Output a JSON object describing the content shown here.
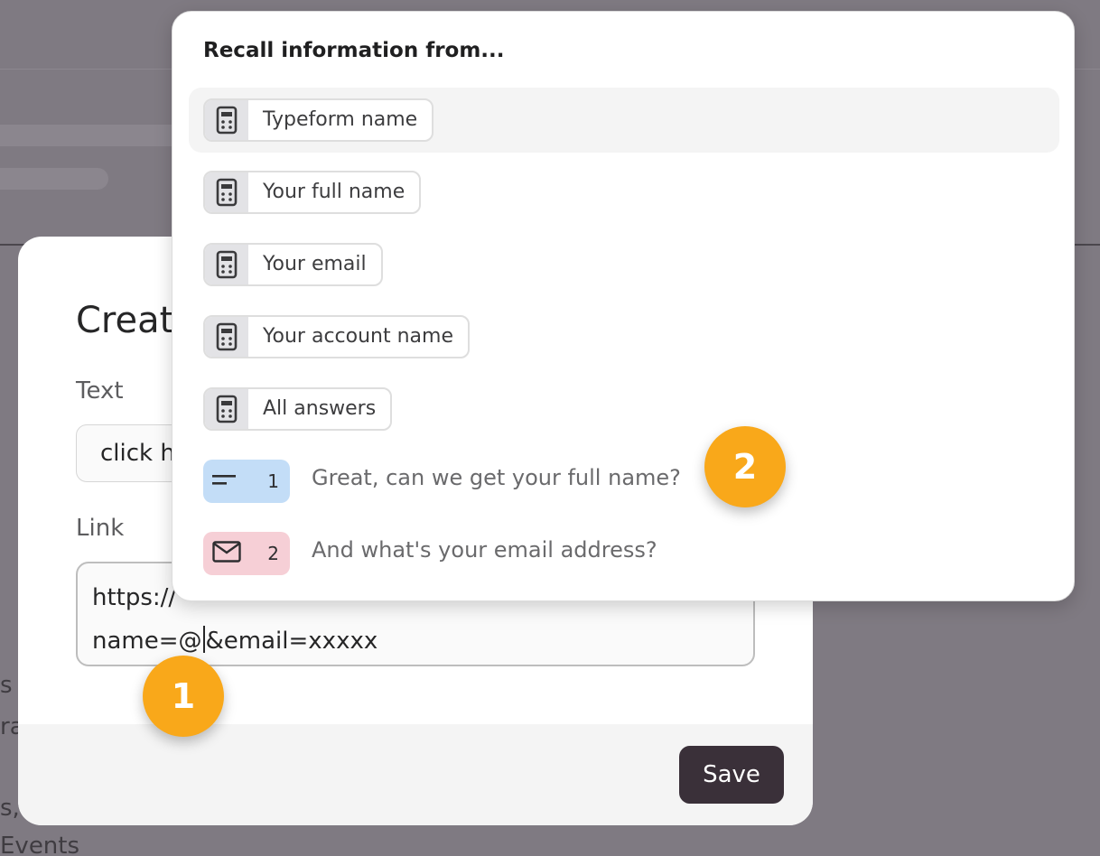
{
  "background": {
    "fragments": [
      "s",
      "ra",
      "s,",
      "Events"
    ]
  },
  "modal": {
    "title": "Create",
    "text_label": "Text",
    "text_value": "click h",
    "link_label": "Link",
    "link_line1": "https://",
    "link_before_caret": "name=@",
    "link_after_caret": "&email=xxxxx",
    "save_label": "Save"
  },
  "recall": {
    "title": "Recall information from...",
    "variables": [
      {
        "label": "Typeform name",
        "icon": "calculator-icon",
        "highlighted": true
      },
      {
        "label": "Your full name",
        "icon": "calculator-icon"
      },
      {
        "label": "Your email",
        "icon": "calculator-icon"
      },
      {
        "label": "Your account name",
        "icon": "calculator-icon"
      },
      {
        "label": "All answers",
        "icon": "calculator-icon"
      }
    ],
    "questions": [
      {
        "number": "1",
        "icon": "short-text-icon",
        "text": "Great, can we get your full name?",
        "color": "#c3ddf7"
      },
      {
        "number": "2",
        "icon": "email-icon",
        "text": "And what's your email address?",
        "color": "#f6cfd6"
      }
    ]
  },
  "markers": [
    "1",
    "2"
  ],
  "colors": {
    "marker": "#f9a81a",
    "save_button": "#3a3039",
    "overlay": "#7f7a82"
  }
}
